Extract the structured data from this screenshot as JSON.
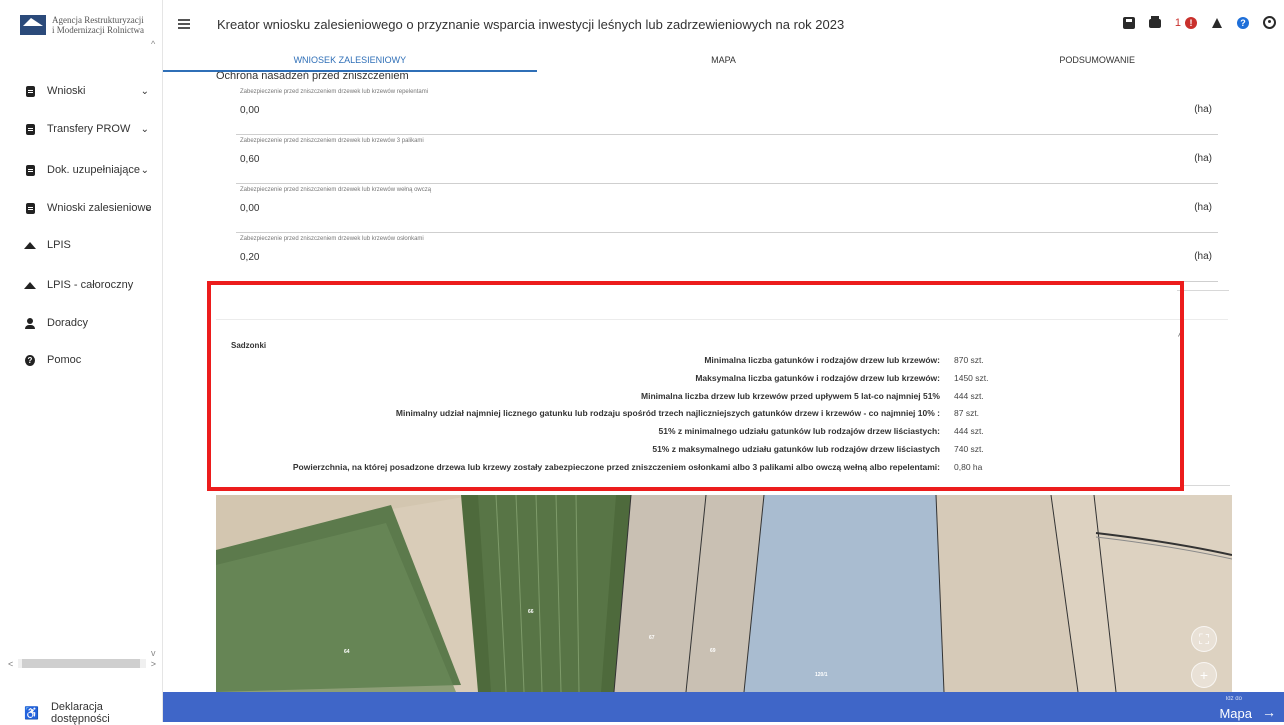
{
  "app": {
    "org_name": "Agencja Restrukturyzacji i Modernizacji Rolnictwa",
    "org_line1": "Agencja Restrukturyzacji",
    "org_line2": "i Modernizacji Rolnictwa",
    "title": "Kreator wniosku zalesieniowego o przyznanie wsparcia inwestycji leśnych lub zadrzewieniowych na rok 2023"
  },
  "header": {
    "alert_count": "1",
    "alert_glyph": "!",
    "help_glyph": "?"
  },
  "sidebar": {
    "items": [
      {
        "label": "Wnioski",
        "icon": "document-icon",
        "chevron": "⌄"
      },
      {
        "label": "Transfery PROW",
        "icon": "document-icon",
        "chevron": "⌄"
      },
      {
        "label": "Dok. uzupełniające",
        "icon": "document-icon",
        "chevron": "⌄"
      },
      {
        "label": "Wnioski zalesieniowe",
        "icon": "document-icon",
        "chevron": "⌄"
      },
      {
        "label": "LPIS",
        "icon": "mountain-icon"
      },
      {
        "label": "LPIS - całoroczny",
        "icon": "mountain-icon"
      },
      {
        "label": "Doradcy",
        "icon": "user-icon"
      },
      {
        "label": "Pomoc",
        "icon": "help-icon",
        "glyph": "?"
      }
    ],
    "footer": "Deklaracja dostępności"
  },
  "tabs": [
    {
      "label": "WNIOSEK ZALESIENIOWY",
      "active": true
    },
    {
      "label": "MAPA",
      "active": false
    },
    {
      "label": "PODSUMOWANIE",
      "active": false
    }
  ],
  "protection": {
    "section_title": "Ochrona nasadzeń przed zniszczeniem",
    "fields": [
      {
        "label": "Zabezpieczenie przed zniszczeniem drzewek lub krzewów repelentami",
        "value": "0,00",
        "unit": "(ha)"
      },
      {
        "label": "Zabezpieczenie przed zniszczeniem drzewek lub krzewów 3 palikami",
        "value": "0,60",
        "unit": "(ha)"
      },
      {
        "label": "Zabezpieczenie przed zniszczeniem drzewek lub krzewów wełną owczą",
        "value": "0,00",
        "unit": "(ha)"
      },
      {
        "label": "Zabezpieczenie przed zniszczeniem drzewek lub krzewów osłonkami",
        "value": "0,20",
        "unit": "(ha)"
      }
    ]
  },
  "sadzonki": {
    "title": "Sadzonki",
    "rows": [
      {
        "label": "Minimalna liczba gatunków i rodzajów drzew lub krzewów:",
        "value": "870 szt."
      },
      {
        "label": "Maksymalna liczba gatunków i rodzajów drzew lub krzewów:",
        "value": "1450 szt."
      },
      {
        "label": "Minimalna liczba drzew lub krzewów przed upływem 5 lat-co najmniej 51%",
        "value": "444 szt."
      },
      {
        "label": "Minimalny udział najmniej licznego gatunku lub rodzaju spośród trzech najliczniejszych gatunków drzew i krzewów - co najmniej 10% :",
        "value": "87 szt."
      },
      {
        "label": "51% z minimalnego udziału gatunków lub rodzajów drzew liściastych:",
        "value": "444 szt."
      },
      {
        "label": "51% z maksymalnego udziału gatunków lub rodzajów drzew liściastych",
        "value": "740 szt."
      },
      {
        "label": "Powierzchnia, na której posadzone drzewa lub krzewy zostały zabezpieczone przed zniszczeniem osłonkami albo 3 palikami albo owczą wełną albo repelentami:",
        "value": "0,80 ha"
      }
    ]
  },
  "map": {
    "parcel_labels": [
      "64",
      "66",
      "67",
      "69",
      "120/1"
    ],
    "fullscreen_icon": "⛶",
    "zoom_in_icon": "+"
  },
  "bottom": {
    "goto_small": "Idź do",
    "goto_label": "Mapa",
    "goto_arrow": "→"
  },
  "colors": {
    "accent": "#3f66c8",
    "highlight": "#ec1c1c",
    "tab_active": "#2f6fb7"
  }
}
